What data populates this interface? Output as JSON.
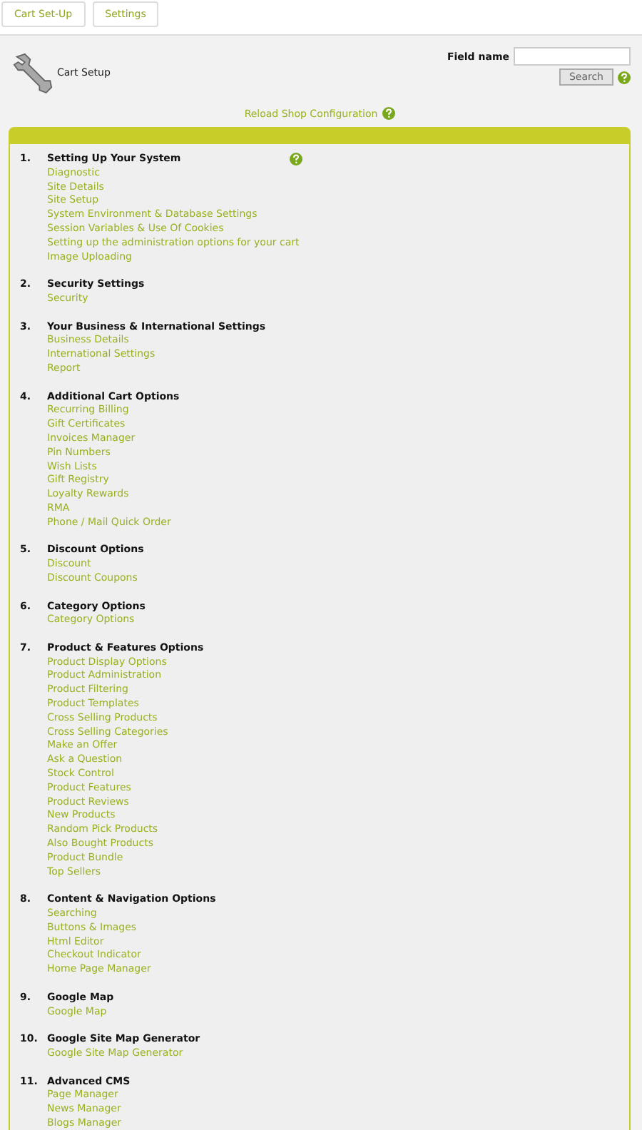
{
  "tabs": [
    {
      "label": "Cart Set-Up"
    },
    {
      "label": "Settings"
    }
  ],
  "header": {
    "title": "Cart Setup",
    "field_label": "Field name",
    "search_button": "Search",
    "reload_link": "Reload Shop Configuration"
  },
  "sections": [
    {
      "number": "1.",
      "title": "Setting Up Your System",
      "help": true,
      "links": [
        "Diagnostic",
        "Site Details",
        "Site Setup",
        "System Environment & Database Settings",
        "Session Variables & Use Of Cookies",
        "Setting up the administration options for your cart",
        "Image Uploading"
      ]
    },
    {
      "number": "2.",
      "title": "Security Settings",
      "help": false,
      "links": [
        "Security"
      ]
    },
    {
      "number": "3.",
      "title": "Your Business & International Settings",
      "help": false,
      "links": [
        "Business Details",
        "International Settings",
        "Report"
      ]
    },
    {
      "number": "4.",
      "title": "Additional Cart Options",
      "help": false,
      "links": [
        "Recurring Billing",
        "Gift Certificates",
        "Invoices Manager",
        "Pin Numbers",
        "Wish Lists",
        "Gift Registry",
        "Loyalty Rewards",
        "RMA",
        "Phone / Mail Quick Order"
      ]
    },
    {
      "number": "5.",
      "title": "Discount Options",
      "help": false,
      "links": [
        "Discount",
        "Discount Coupons"
      ]
    },
    {
      "number": "6.",
      "title": "Category Options",
      "help": false,
      "links": [
        "Category Options"
      ]
    },
    {
      "number": "7.",
      "title": "Product & Features Options",
      "help": false,
      "links": [
        "Product Display Options",
        "Product Administration",
        "Product Filtering",
        "Product Templates",
        "Cross Selling Products",
        "Cross Selling Categories",
        "Make an Offer",
        "Ask a Question",
        "Stock Control",
        "Product Features",
        "Product Reviews",
        "New Products",
        "Random Pick Products",
        "Also Bought Products",
        "Product Bundle",
        "Top Sellers"
      ]
    },
    {
      "number": "8.",
      "title": "Content & Navigation Options",
      "help": false,
      "links": [
        "Searching",
        "Buttons & Images",
        "Html Editor",
        "Checkout Indicator",
        "Home Page Manager"
      ]
    },
    {
      "number": "9.",
      "title": "Google Map",
      "help": false,
      "links": [
        "Google Map"
      ]
    },
    {
      "number": "10.",
      "title": "Google Site Map Generator",
      "help": false,
      "links": [
        "Google Site Map Generator"
      ]
    },
    {
      "number": "11.",
      "title": "Advanced CMS",
      "help": false,
      "links": [
        "Page Manager",
        "News Manager",
        "Blogs Manager"
      ]
    }
  ]
}
